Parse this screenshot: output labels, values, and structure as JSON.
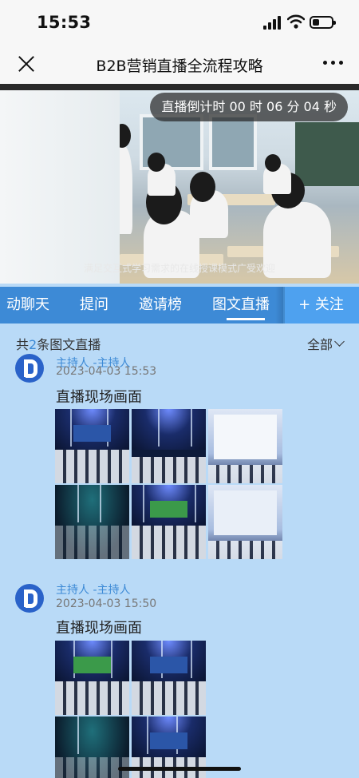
{
  "status_bar": {
    "time": "15:53"
  },
  "nav": {
    "title": "B2B营销直播全流程攻略"
  },
  "video": {
    "countdown": "直播倒计时 00 时 06 分 04 秒",
    "subtitle": "满足交互式学习需求的在线授课模式广受欢迎"
  },
  "tabs": [
    {
      "label": "动聊天"
    },
    {
      "label": "提问"
    },
    {
      "label": "邀请榜"
    },
    {
      "label": "图文直播",
      "active": true
    }
  ],
  "follow_button": "+ 关注",
  "filter": {
    "count_prefix": "共",
    "count": "2",
    "count_suffix": "条图文直播",
    "filter_label": "全部"
  },
  "posts": [
    {
      "author": "主持人 -主持人",
      "time": "2023-04-03 15:53",
      "text": "直播现场画面",
      "image_count": 6
    },
    {
      "author": "主持人 -主持人",
      "time": "2023-04-03 15:50",
      "text": "直播现场画面",
      "image_count": 4
    }
  ],
  "colors": {
    "accent": "#3d8ad6",
    "background": "#b9daf7",
    "avatar": "#2a62c9"
  },
  "icons": {
    "close": "close-icon",
    "more": "more-icon",
    "chevron": "chevron-down-icon",
    "avatar": "polyv-logo-icon"
  }
}
